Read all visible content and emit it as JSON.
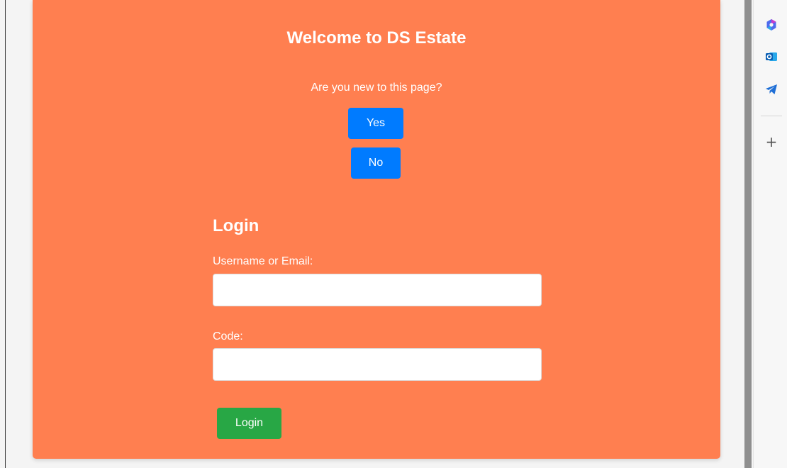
{
  "welcome": {
    "title": "Welcome to DS Estate",
    "question": "Are you new to this page?",
    "yes_label": "Yes",
    "no_label": "No"
  },
  "login": {
    "heading": "Login",
    "username_label": "Username or Email:",
    "username_value": "",
    "code_label": "Code:",
    "code_value": "",
    "submit_label": "Login"
  },
  "sidebar": {
    "icons": [
      "copilot-icon",
      "outlook-icon",
      "telegram-icon",
      "plus-icon"
    ],
    "plus_glyph": "+"
  },
  "colors": {
    "card_background": "#ff7f50",
    "primary_button": "#007bff",
    "login_button": "#28a745"
  }
}
